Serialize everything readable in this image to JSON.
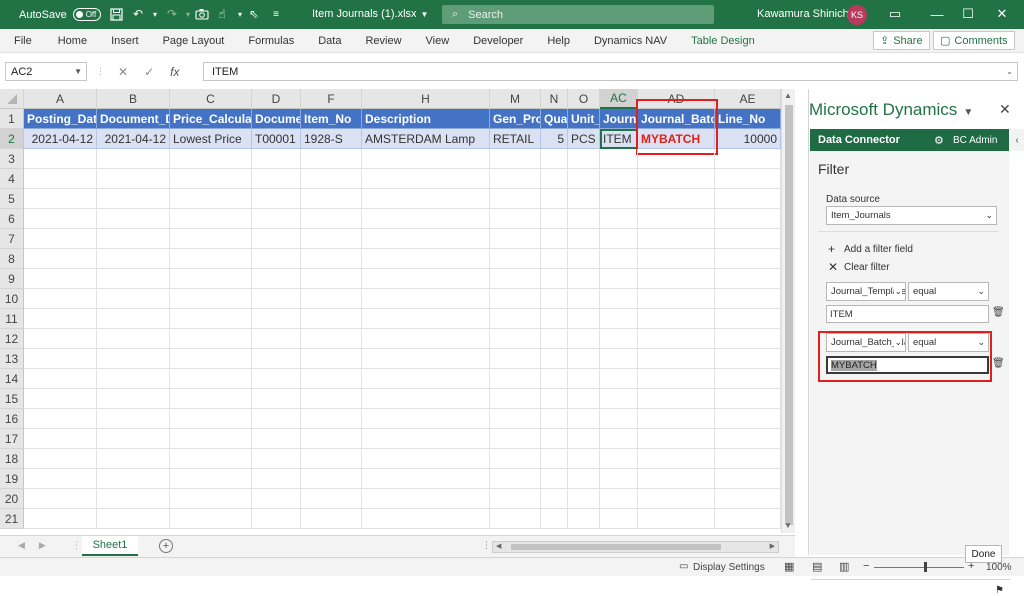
{
  "titlebar": {
    "autosave_label": "AutoSave",
    "autosave_state": "Off",
    "file_name": "Item Journals (1).xlsx",
    "file_dd": "⌄",
    "search_placeholder": "Search",
    "user_name": "Kawamura Shinichi",
    "user_initials": "KS"
  },
  "ribbon": {
    "tabs": [
      "File",
      "Home",
      "Insert",
      "Page Layout",
      "Formulas",
      "Data",
      "Review",
      "View",
      "Developer",
      "Help",
      "Dynamics NAV",
      "Table Design"
    ],
    "share_label": "Share",
    "comments_label": "Comments"
  },
  "formula_bar": {
    "name_box": "AC2",
    "fx": "fx",
    "value": "ITEM"
  },
  "grid": {
    "columns": [
      {
        "letter": "A",
        "header": "Posting_Date",
        "value": "2021-04-12"
      },
      {
        "letter": "B",
        "header": "Document_Date",
        "value": "2021-04-12"
      },
      {
        "letter": "C",
        "header": "Price_Calculation",
        "value": "Lowest Price"
      },
      {
        "letter": "D",
        "header": "Document_No",
        "value": "T00001"
      },
      {
        "letter": "F",
        "header": "Item_No",
        "value": "1928-S"
      },
      {
        "letter": "H",
        "header": "Description",
        "value": "AMSTERDAM Lamp"
      },
      {
        "letter": "M",
        "header": "Gen_Prod",
        "value": "RETAIL"
      },
      {
        "letter": "N",
        "header": "Quantity",
        "value": "5"
      },
      {
        "letter": "O",
        "header": "Unit_of",
        "value": "PCS"
      },
      {
        "letter": "AC",
        "header": "Journal_Template",
        "value": "ITEM"
      },
      {
        "letter": "AD",
        "header": "Journal_Batch",
        "value": "MYBATCH"
      },
      {
        "letter": "AE",
        "header": "Line_No",
        "value": "10000"
      }
    ],
    "row_numbers": [
      "1",
      "2",
      "3",
      "4",
      "5",
      "6",
      "7",
      "8",
      "9",
      "10",
      "11",
      "12",
      "13",
      "14",
      "15",
      "16",
      "17",
      "18",
      "19",
      "20",
      "21"
    ],
    "selected_cell": "AC2"
  },
  "sheets": {
    "active": "Sheet1",
    "add": "+"
  },
  "statusbar": {
    "display_settings": "Display Settings",
    "zoom": "100%",
    "minus": "−",
    "plus": "+"
  },
  "pane": {
    "title": "Microsoft Dynamics",
    "connector": "Data Connector",
    "admin": "BC Admin",
    "filter_title": "Filter",
    "data_source_label": "Data source",
    "data_source_value": "Item_Journals",
    "add_filter": "Add a filter field",
    "clear_filter": "Clear filter",
    "filters": [
      {
        "field": "Journal_Template_Name",
        "op": "equal",
        "value": "ITEM"
      },
      {
        "field": "Journal_Batch_Name",
        "op": "equal",
        "value": "MYBATCH"
      }
    ],
    "done": "Done"
  },
  "colors": {
    "excel_green": "#217346",
    "table_header": "#4472c4",
    "table_row": "#d9e1f2",
    "highlight_red": "#e0201b"
  },
  "icons": [
    "save-icon",
    "undo-icon",
    "redo-icon",
    "camera-icon",
    "touch-icon",
    "cursor-icon",
    "search-icon",
    "gear-icon",
    "close-icon",
    "trash-icon",
    "plus-icon",
    "flag-icon"
  ]
}
